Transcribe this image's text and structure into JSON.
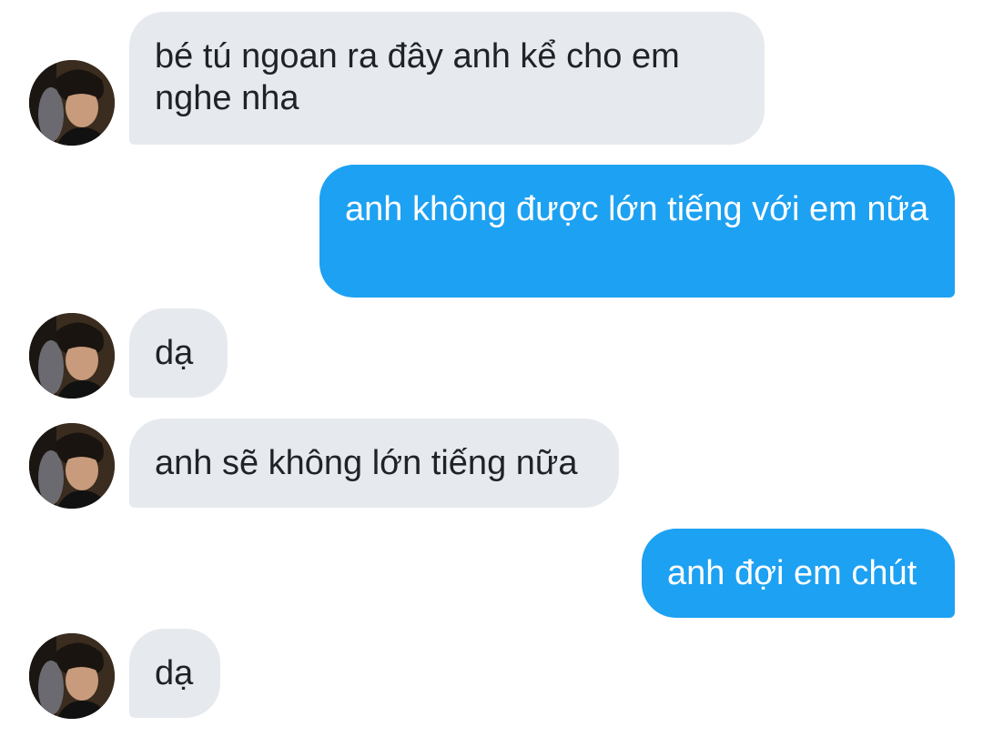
{
  "conversation": {
    "messages": [
      {
        "side": "in",
        "text": "bé tú ngoan ra đây anh kể cho em nghe nha",
        "avatar_icon": "contact-avatar"
      },
      {
        "side": "out",
        "text": "anh không được lớn tiếng với em nữa"
      },
      {
        "side": "in",
        "text": "dạ",
        "avatar_icon": "contact-avatar"
      },
      {
        "side": "in",
        "text": "anh sẽ không lớn tiếng nữa",
        "avatar_icon": "contact-avatar"
      },
      {
        "side": "out",
        "text": "anh đợi em chút"
      },
      {
        "side": "in",
        "text": "dạ",
        "avatar_icon": "contact-avatar"
      }
    ]
  },
  "colors": {
    "incoming_bubble": "#e6eaee",
    "outgoing_bubble": "#1da1f2",
    "incoming_text": "#1f2328",
    "outgoing_text": "#ffffff",
    "background": "#ffffff"
  }
}
